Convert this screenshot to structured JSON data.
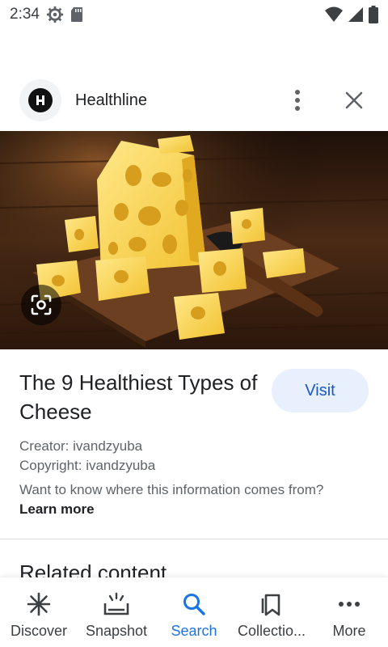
{
  "status_bar": {
    "time": "2:34",
    "icons": [
      "settings-gear-icon",
      "sd-card-icon",
      "wifi-icon",
      "cell-signal-icon",
      "battery-icon"
    ]
  },
  "header": {
    "site_name": "Healthline",
    "logo_icon": "healthline-logo-icon",
    "more_icon": "more-vertical-icon",
    "close_icon": "close-icon"
  },
  "hero": {
    "image_icon": "cheese-photo",
    "lens_icon": "google-lens-icon"
  },
  "result": {
    "title": "The 9 Healthiest Types of Cheese",
    "visit_label": "Visit",
    "creator": "Creator: ivandzyuba",
    "copyright": "Copyright: ivandzyuba",
    "info_text": "Want to know where this information comes from?",
    "learn_more": "Learn more",
    "related_heading": "Related content"
  },
  "bottom_nav": {
    "items": [
      {
        "label": "Discover",
        "icon": "asterisk-icon",
        "active": false
      },
      {
        "label": "Snapshot",
        "icon": "snapshot-icon",
        "active": false
      },
      {
        "label": "Search",
        "icon": "search-icon",
        "active": true
      },
      {
        "label": "Collectio...",
        "icon": "collections-bookmark-icon",
        "active": false
      },
      {
        "label": "More",
        "icon": "more-horizontal-icon",
        "active": false
      }
    ]
  },
  "colors": {
    "accent": "#1a73e8",
    "visit_bg": "#e8f0fe",
    "visit_text": "#1a57c8"
  }
}
